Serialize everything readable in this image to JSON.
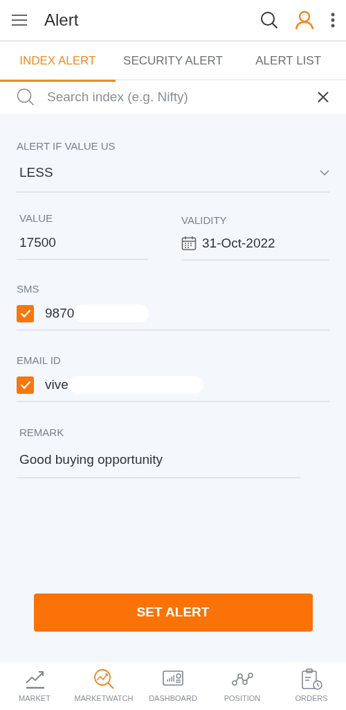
{
  "app_bar": {
    "title": "Alert"
  },
  "tabs": [
    {
      "label": "INDEX ALERT",
      "selected": true
    },
    {
      "label": "SECURITY ALERT",
      "selected": false
    },
    {
      "label": "ALERT LIST",
      "selected": false
    }
  ],
  "search": {
    "placeholder": "Search index (e.g. Nifty)"
  },
  "condition": {
    "label": "ALERT IF VALUE US",
    "value": "LESS"
  },
  "value_field": {
    "label": "VALUE",
    "value": "17500"
  },
  "validity": {
    "label": "VALIDITY",
    "value": "31-Oct-2022"
  },
  "sms": {
    "label": "SMS",
    "checked": true,
    "value": "9870"
  },
  "email": {
    "label": "EMAIL ID",
    "checked": true,
    "value": "vive"
  },
  "remark": {
    "label": "REMARK",
    "value": "Good buying opportunity"
  },
  "submit": {
    "label": "SET ALERT"
  },
  "bottom_nav": [
    {
      "kind": "market",
      "label": "MARKET",
      "selected": false
    },
    {
      "kind": "marketwatch",
      "label": "MARKETWATCH",
      "selected": true
    },
    {
      "kind": "dashboard",
      "label": "DASHBOARD",
      "selected": false
    },
    {
      "kind": "position",
      "label": "POSITION",
      "selected": false
    },
    {
      "kind": "orders",
      "label": "ORDERS",
      "selected": false
    }
  ]
}
